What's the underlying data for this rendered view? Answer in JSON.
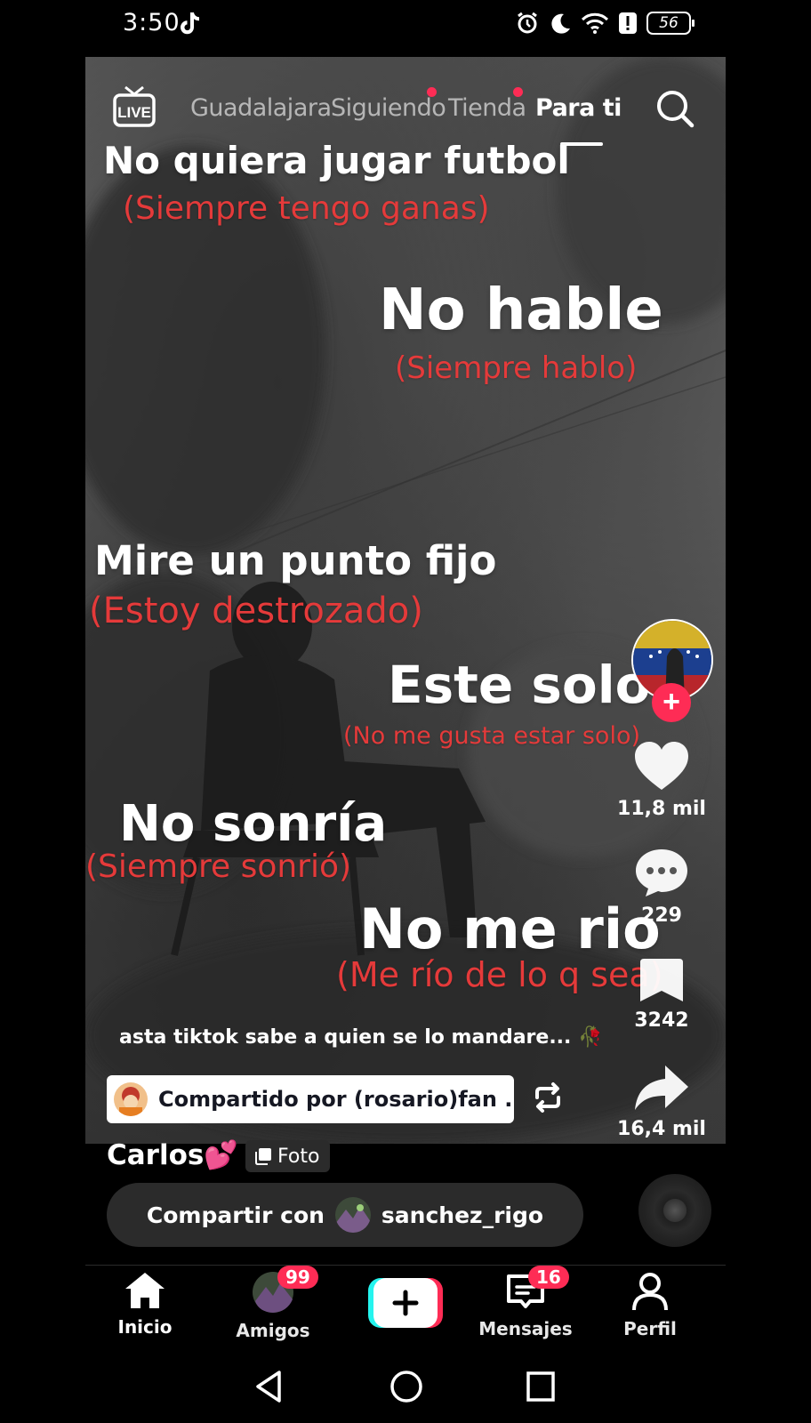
{
  "status_bar": {
    "time": "3:50",
    "battery": "56",
    "icons": [
      "tiktok-icon",
      "alarm-icon",
      "moon-icon",
      "wifi-icon",
      "alert-icon",
      "battery-icon"
    ]
  },
  "top_nav": {
    "live_label": "LIVE",
    "tabs": [
      {
        "label": "Guadalajara",
        "dot": false
      },
      {
        "label": "Siguiendo",
        "dot": true
      },
      {
        "label": "Tienda",
        "dot": true
      },
      {
        "label": "Para ti",
        "active": true
      }
    ]
  },
  "overlay": {
    "l1_white": "No quiera jugar futbol",
    "l1_red": "(Siempre tengo ganas)",
    "l2_white": "No hable",
    "l2_red": "(Siempre hablo)",
    "l3_white": "Mire un punto fijo",
    "l3_red": "(Estoy destrozado)",
    "l4_white": "Este solo",
    "l4_red": "(No me gusta estar solo)",
    "l5_white": "No sonría",
    "l5_red": "(Siempre sonrió)",
    "l6_white": "No me rio",
    "l6_red": "(Me río de lo q sea)",
    "caption": "asta tiktok sabe a quien se lo mandare... 🥀"
  },
  "rail": {
    "likes": "11,8 mil",
    "comments": "229",
    "saves": "3242",
    "shares": "16,4 mil"
  },
  "shared_by": "Compartido por (rosario)fan ...",
  "author": {
    "name": "Carlos💕",
    "badge": "Foto"
  },
  "share_with": {
    "prefix": "Compartir con",
    "user": "sanchez_rigo"
  },
  "bottom_nav": {
    "home": "Inicio",
    "friends": "Amigos",
    "friends_badge": "99",
    "messages": "Mensajes",
    "messages_badge": "16",
    "profile": "Perfil"
  },
  "colors": {
    "accent": "#fe2c55",
    "overlay_red": "#e53a3a",
    "cyan": "#25f4ee"
  }
}
